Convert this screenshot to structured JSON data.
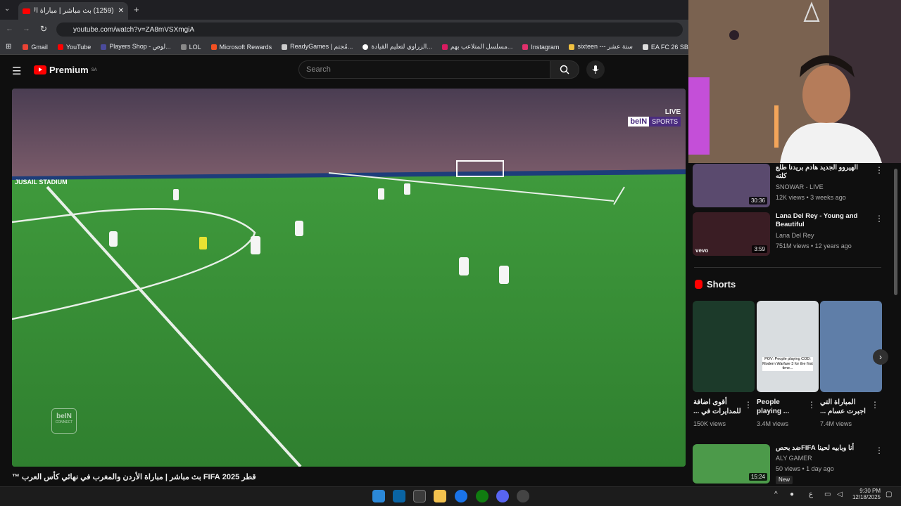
{
  "browser": {
    "tab_title": "(1259) بث مباشر | مباراة الأرد",
    "url": "youtube.com/watch?v=ZA8mVSXmgiA",
    "bookmarks": [
      {
        "label": "Gmail",
        "color": "#ea4335"
      },
      {
        "label": "YouTube",
        "color": "#ff0000"
      },
      {
        "label": "Players Shop - لوص...",
        "color": "#4b4b9b"
      },
      {
        "label": "LOL",
        "color": "#888888"
      },
      {
        "label": "Microsoft Rewards",
        "color": "#f25022"
      },
      {
        "label": "ReadyGames | مُجتم...",
        "color": "#cccccc"
      },
      {
        "label": "الزراوي لتعليم القيادة...",
        "color": "#ffffff"
      },
      {
        "label": "مسلسل المتلاعب بهم...",
        "color": "#d81b60"
      },
      {
        "label": "Instagram",
        "color": "#e1306c"
      },
      {
        "label": "sixteen --- ستة عشر",
        "color": "#f0c040"
      },
      {
        "label": "EA FC 26 SBC Soluti...",
        "color": "#dddddd"
      }
    ]
  },
  "youtube": {
    "logo_text": "Premium",
    "region": "SA",
    "search_placeholder": "Search"
  },
  "video": {
    "overlay_live": "LIVE",
    "overlay_brand": "beIN",
    "overlay_brand_sub": "SPORTS",
    "stadium": "JUSAIL STADIUM",
    "watermark": "beIN",
    "watermark_sub": "CONNECT",
    "title": "قطر 2025 FIFA بث مباشر | مباراة الأردن والمغرب في نهائي كأس العرب ™"
  },
  "sidebar": {
    "items": [
      {
        "title": "الهيروو الجديد هادم بريدنا طلع كلته",
        "channel": "SNOWAR - LIVE",
        "meta": "12K views • 3 weeks ago",
        "duration": "30:36",
        "thumb": "#5a4a6e"
      },
      {
        "title": "Lana Del Rey - Young and Beautiful",
        "channel": "Lana Del Rey",
        "meta": "751M views • 12 years ago",
        "duration": "3:59",
        "thumb": "#3a1d24",
        "badge": "vevo"
      }
    ],
    "shorts_heading": "Shorts",
    "shorts": [
      {
        "title": "أقوى اضافة للمدايرات في ...",
        "views": "150K views",
        "color": "#1c3a2a"
      },
      {
        "title": "People playing ...",
        "views": "3.4M views",
        "color": "#d9dde0",
        "caption": "POV: People playing COD: Modern Warfare 3 for the first time..."
      },
      {
        "title": "المباراة التي اجبرت عسام ...",
        "views": "7.4M views",
        "color": "#5f7ea8"
      }
    ],
    "last_item": {
      "title": "أنا وبابيه لحينا FIFAضد بحص",
      "channel": "ALY GAMER",
      "meta": "50 views • 1 day ago",
      "badge": "New",
      "duration": "15:24"
    }
  },
  "taskbar": {
    "time": "9:30 PM",
    "date": "12/18/2025"
  }
}
